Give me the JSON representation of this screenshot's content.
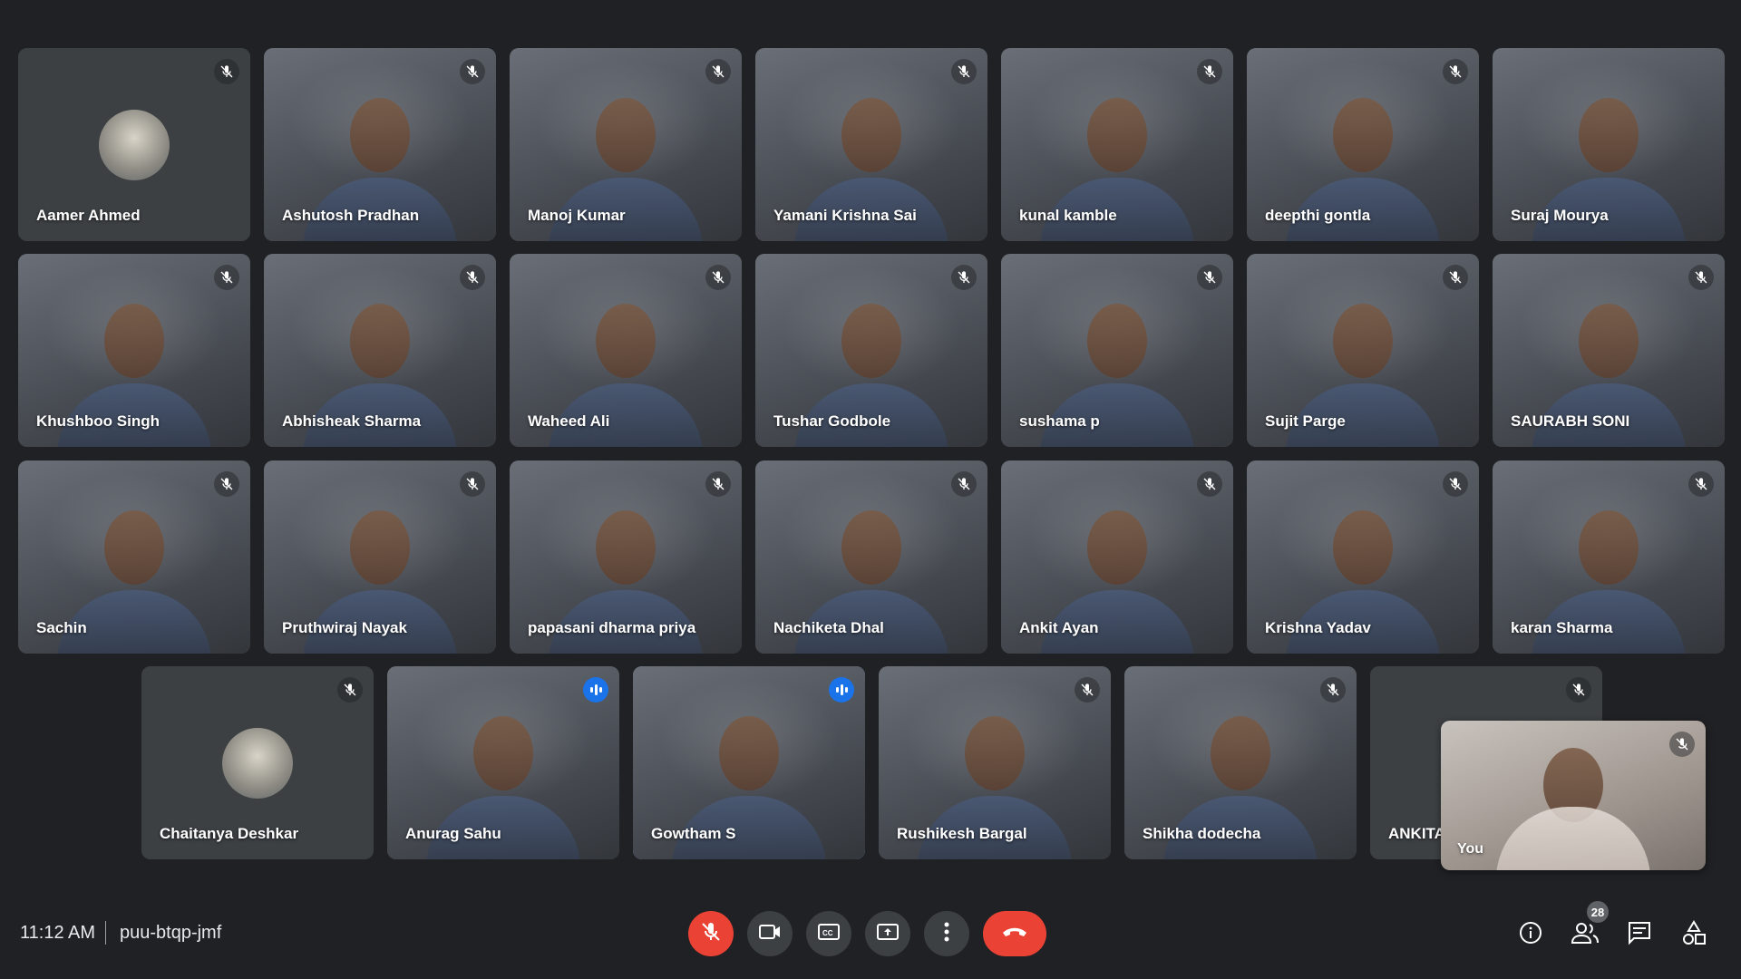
{
  "participants": [
    {
      "name": "Aamer Ahmed",
      "video": false,
      "muted": true
    },
    {
      "name": "Ashutosh Pradhan",
      "video": true,
      "muted": true
    },
    {
      "name": "Manoj Kumar",
      "video": true,
      "muted": true
    },
    {
      "name": "Yamani Krishna Sai",
      "video": true,
      "muted": true
    },
    {
      "name": "kunal kamble",
      "video": true,
      "muted": true
    },
    {
      "name": "deepthi gontla",
      "video": true,
      "muted": true
    },
    {
      "name": "Suraj Mourya",
      "video": true,
      "muted": false
    },
    {
      "name": "Khushboo Singh",
      "video": true,
      "muted": true
    },
    {
      "name": "Abhisheak Sharma",
      "video": true,
      "muted": true
    },
    {
      "name": "Waheed Ali",
      "video": true,
      "muted": true
    },
    {
      "name": "Tushar Godbole",
      "video": true,
      "muted": true
    },
    {
      "name": "sushama p",
      "video": true,
      "muted": true
    },
    {
      "name": "Sujit Parge",
      "video": true,
      "muted": true
    },
    {
      "name": "SAURABH SONI",
      "video": true,
      "muted": true
    },
    {
      "name": "Sachin",
      "video": true,
      "muted": true
    },
    {
      "name": "Pruthwiraj Nayak",
      "video": true,
      "muted": true
    },
    {
      "name": "papasani dharma priya",
      "video": true,
      "muted": true
    },
    {
      "name": "Nachiketa Dhal",
      "video": true,
      "muted": true
    },
    {
      "name": "Ankit Ayan",
      "video": true,
      "muted": true
    },
    {
      "name": "Krishna Yadav",
      "video": true,
      "muted": true
    },
    {
      "name": "karan Sharma",
      "video": true,
      "muted": true
    },
    {
      "name": "Chaitanya Deshkar",
      "video": false,
      "muted": true
    },
    {
      "name": "Anurag Sahu",
      "video": true,
      "muted": false,
      "speaking": true
    },
    {
      "name": "Gowtham S",
      "video": true,
      "muted": false,
      "speaking": true,
      "active": true
    },
    {
      "name": "Rushikesh Bargal",
      "video": true,
      "muted": true
    },
    {
      "name": "Shikha dodecha",
      "video": true,
      "muted": true
    },
    {
      "name": "ANKITA",
      "video": false,
      "muted": true
    }
  ],
  "self_view": {
    "name": "You",
    "muted": true
  },
  "bottom_bar": {
    "time": "11:12 AM",
    "meeting_code": "puu-btqp-jmf",
    "participant_count": "28"
  },
  "colors": {
    "background": "#202124",
    "tile": "#3c4043",
    "mic_off_red": "#ea4335",
    "speaking_blue": "#1a73e8",
    "active_border": "#8ab4f8"
  },
  "icons": {
    "mute": "mic-off-icon",
    "speaking": "audio-bars-icon",
    "mic": "mic-off-icon",
    "camera": "camera-icon",
    "captions": "captions-icon",
    "present": "present-icon",
    "more": "more-vert-icon",
    "end_call": "phone-hangup-icon",
    "info": "info-icon",
    "people": "people-icon",
    "chat": "chat-icon",
    "activities": "activities-icon"
  }
}
